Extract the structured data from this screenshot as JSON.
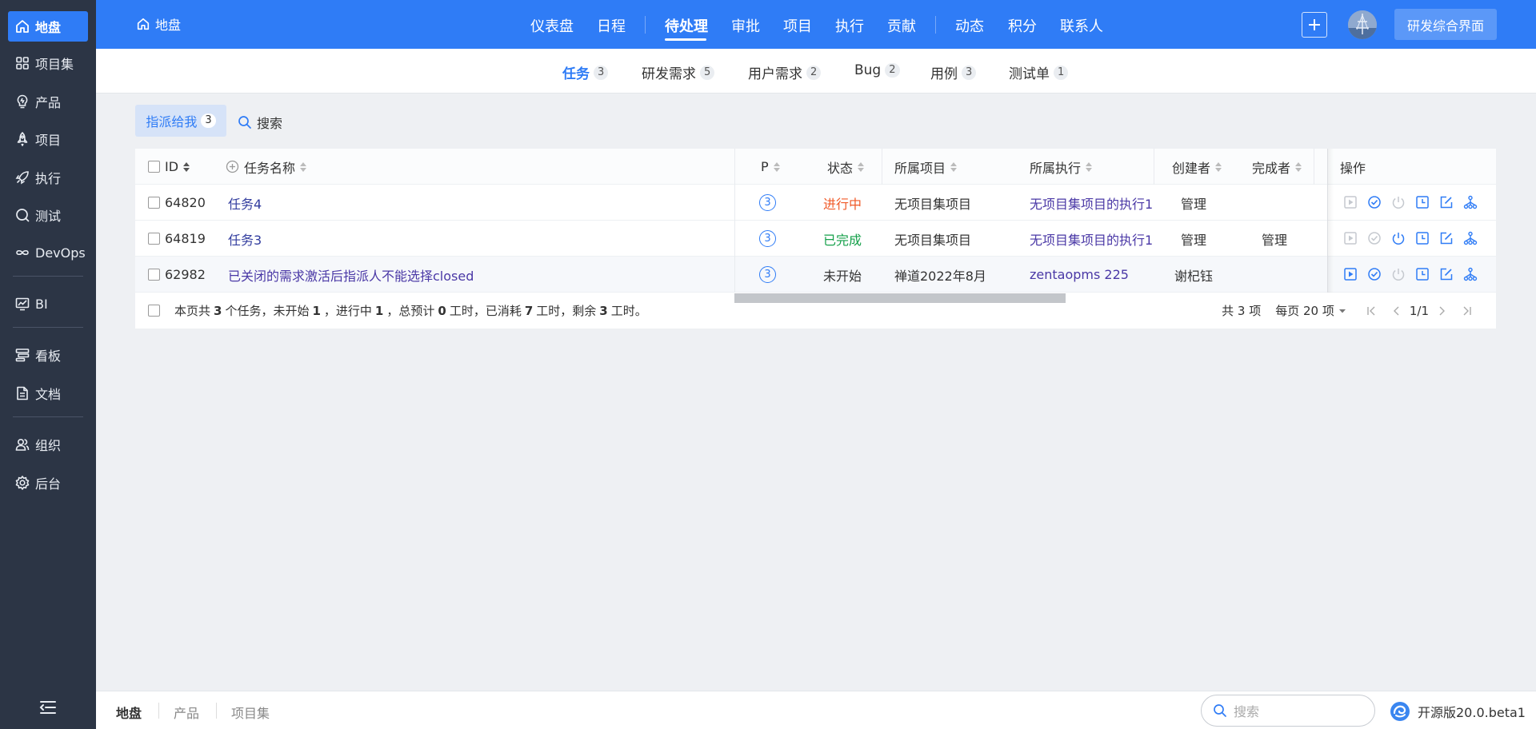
{
  "sidebar": {
    "items": [
      {
        "label": "地盘",
        "icon": "home-icon"
      },
      {
        "label": "项目集",
        "icon": "grid-icon"
      },
      {
        "label": "产品",
        "icon": "bulb-icon"
      },
      {
        "label": "项目",
        "icon": "rocket-icon"
      },
      {
        "label": "执行",
        "icon": "run-icon"
      },
      {
        "label": "测试",
        "icon": "test-icon"
      },
      {
        "label": "DevOps",
        "icon": "infinity-icon"
      },
      {
        "label": "BI",
        "icon": "chart-icon"
      },
      {
        "label": "看板",
        "icon": "kanban-icon"
      },
      {
        "label": "文档",
        "icon": "doc-icon"
      },
      {
        "label": "组织",
        "icon": "people-icon"
      },
      {
        "label": "后台",
        "icon": "gear-icon"
      }
    ]
  },
  "header": {
    "crumb": "地盘",
    "menu": [
      "仪表盘",
      "日程",
      "待处理",
      "审批",
      "项目",
      "执行",
      "贡献",
      "动态",
      "积分",
      "联系人"
    ],
    "switch_button": "研发综合界面"
  },
  "subnav": {
    "tabs": [
      {
        "label": "任务",
        "count": "3"
      },
      {
        "label": "研发需求",
        "count": "5"
      },
      {
        "label": "用户需求",
        "count": "2"
      },
      {
        "label": "Bug",
        "count": "2"
      },
      {
        "label": "用例",
        "count": "3"
      },
      {
        "label": "测试单",
        "count": "1"
      }
    ]
  },
  "filter": {
    "assigned_label": "指派给我",
    "assigned_count": "3",
    "search_label": "搜索"
  },
  "table": {
    "columns": {
      "id": "ID",
      "name": "任务名称",
      "pri": "P",
      "status": "状态",
      "project": "所属项目",
      "execution": "所属执行",
      "creator": "创建者",
      "finisher": "完成者",
      "actions": "操作"
    },
    "rows": [
      {
        "id": "64820",
        "name": "任务4",
        "pri": "3",
        "status": "进行中",
        "project": "无项目集项目",
        "execution": "无项目集项目的执行1",
        "creator": "管理",
        "finisher": ""
      },
      {
        "id": "64819",
        "name": "任务3",
        "pri": "3",
        "status": "已完成",
        "project": "无项目集项目",
        "execution": "无项目集项目的执行1",
        "creator": "管理",
        "finisher": "管理"
      },
      {
        "id": "62982",
        "name": "已关闭的需求激活后指派人不能选择closed",
        "pri": "3",
        "status": "未开始",
        "project": "禅道2022年8月",
        "execution": "zentaopms 225",
        "creator": "谢杞钰",
        "finisher": ""
      }
    ],
    "summary": {
      "t1": "本页共",
      "total": "3",
      "t2": "个任务，未开始",
      "wait": "1",
      "t3": "，进行中",
      "doing": "1",
      "t4": "，总预计",
      "estimate": "0",
      "t5": "工时，已消耗",
      "consumed": "7",
      "t6": "工时，剩余",
      "left": "3",
      "t7": "工时。"
    },
    "pager": {
      "total_text": "共 3 项",
      "per_page": "每页 20 项",
      "page": "1/1"
    }
  },
  "bottombar": {
    "crumbs": [
      "地盘",
      "产品",
      "项目集"
    ],
    "search_placeholder": "搜索",
    "version": "开源版20.0.beta1"
  },
  "colors": {
    "primary": "#2f7cf6",
    "sidebar_bg": "#2c3545",
    "status_doing": "#f05a28",
    "status_done": "#15a04a"
  }
}
